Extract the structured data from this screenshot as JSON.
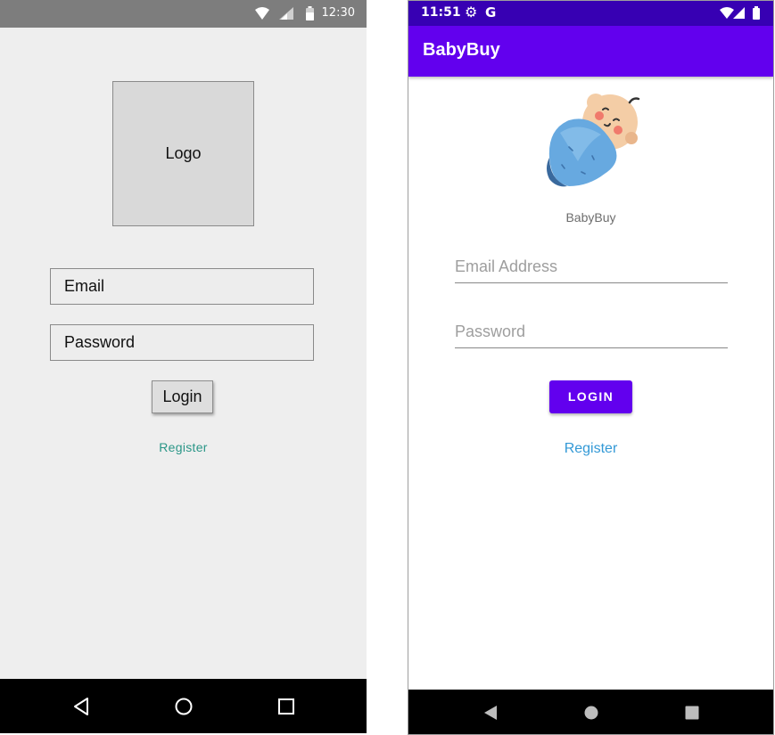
{
  "wireframe": {
    "status_bar": {
      "time": "12:30",
      "icons": [
        "wifi-icon",
        "cell-signal-icon",
        "battery-icon"
      ]
    },
    "logo_placeholder": "Logo",
    "email_field": {
      "placeholder": "Email"
    },
    "password_field": {
      "placeholder": "Password"
    },
    "login_button": "Login",
    "register_link": "Register",
    "nav_bar": {
      "icons": [
        "back-icon",
        "home-icon",
        "recents-icon"
      ]
    }
  },
  "app": {
    "status_bar": {
      "time": "11:51",
      "icons": [
        "settings-icon",
        "google-icon",
        "wifi-icon",
        "cell-signal-icon",
        "battery-icon"
      ],
      "google_glyph": "G"
    },
    "toolbar_title": "BabyBuy",
    "logo_caption": "BabyBuy",
    "email_field": {
      "placeholder": "Email Address"
    },
    "password_field": {
      "placeholder": "Password"
    },
    "login_button": "LOGIN",
    "register_link": "Register",
    "nav_bar": {
      "icons": [
        "back-icon",
        "home-icon",
        "recents-icon"
      ]
    },
    "colors": {
      "status_bar": "#3700b3",
      "primary": "#6200ee",
      "link": "#3399d6"
    }
  }
}
